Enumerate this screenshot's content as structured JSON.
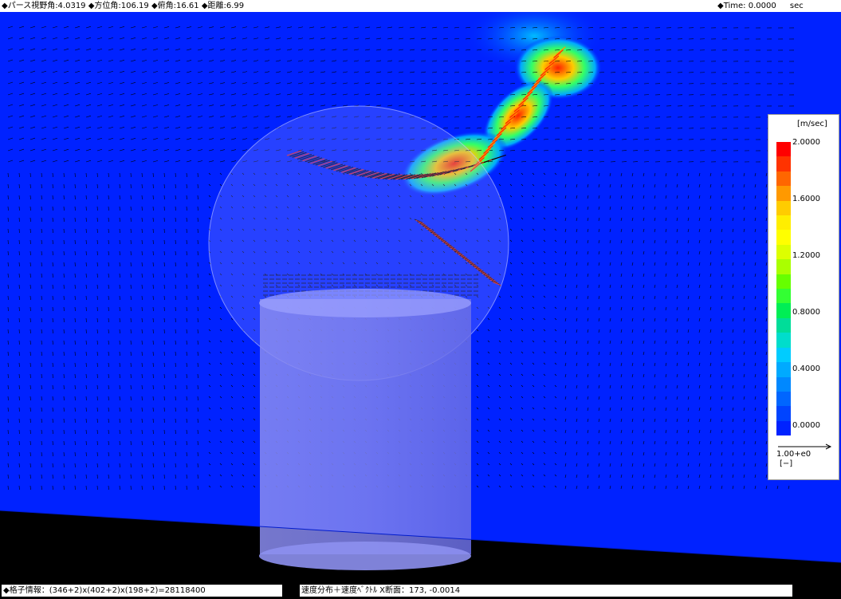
{
  "header": {
    "camera_info": "◆パース視野角:4.0319 ◆方位角:106.19 ◆俯角:16.61 ◆距離:6.99",
    "time_label": "◆Time: 0.0000",
    "time_unit": "sec"
  },
  "legend": {
    "unit": "[m/sec]",
    "ticks": [
      "2.0000",
      "1.6000",
      "1.2000",
      "0.8000",
      "0.4000",
      "0.0000"
    ],
    "colors": [
      "#ff0000",
      "#ff3300",
      "#ff6600",
      "#ff9900",
      "#ffcc00",
      "#ffee00",
      "#ffff00",
      "#ddff00",
      "#aaff00",
      "#66ff00",
      "#33ff33",
      "#00ee55",
      "#00dd99",
      "#00ddcc",
      "#00ccff",
      "#00aaff",
      "#0088ff",
      "#0066ff",
      "#0044ff",
      "#0022ff"
    ],
    "vector_scale": "1.00+e0",
    "vector_scale_unit": "[−]"
  },
  "footer": {
    "grid_info": "◆格子情報：(346+2)x(402+2)x(198+2)=28118400",
    "section_info": "速度分布＋速度ﾍﾞｸﾄﾙ X断面：173, -0.0014"
  },
  "scene": {
    "background_color": "#0022ff",
    "jet_colors": [
      "#ff2200",
      "#ff9900",
      "#ffff00",
      "#33ff66",
      "#00ccff"
    ],
    "arrow_color": "#000000"
  }
}
